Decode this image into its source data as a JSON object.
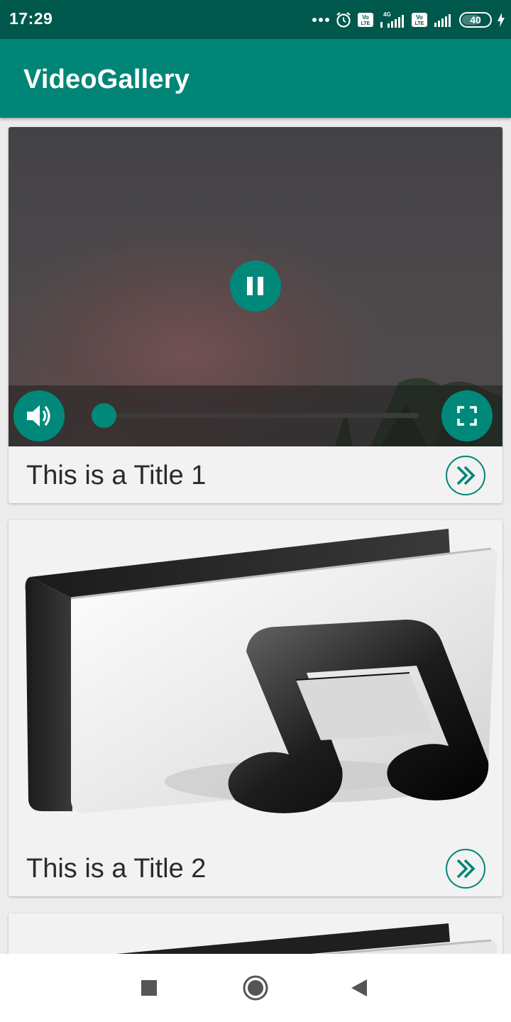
{
  "status_bar": {
    "time": "17:29",
    "battery": "40",
    "network": "4G",
    "icons": [
      "more-dots-icon",
      "alarm-icon",
      "volte-icon",
      "signal-icon",
      "volte-icon",
      "signal-icon",
      "battery-icon",
      "charging-icon"
    ]
  },
  "app_bar": {
    "title": "VideoGallery"
  },
  "colors": {
    "primary": "#008577",
    "primary_dark": "#00574b",
    "accent": "#00897b"
  },
  "cards": [
    {
      "title": "This is a Title 1",
      "media": "video-player",
      "player": {
        "state": "playing",
        "progress": 0.03,
        "controls": [
          "pause-icon",
          "volume-icon",
          "fullscreen-icon"
        ]
      },
      "action_icon": "double-chevron-right-icon"
    },
    {
      "title": "This is a Title 2",
      "media": "music-folder-thumbnail",
      "action_icon": "double-chevron-right-icon"
    },
    {
      "title": "",
      "media": "music-folder-thumbnail"
    }
  ],
  "nav_bar": {
    "buttons": [
      "recents-square-icon",
      "home-circle-icon",
      "back-triangle-icon"
    ]
  }
}
